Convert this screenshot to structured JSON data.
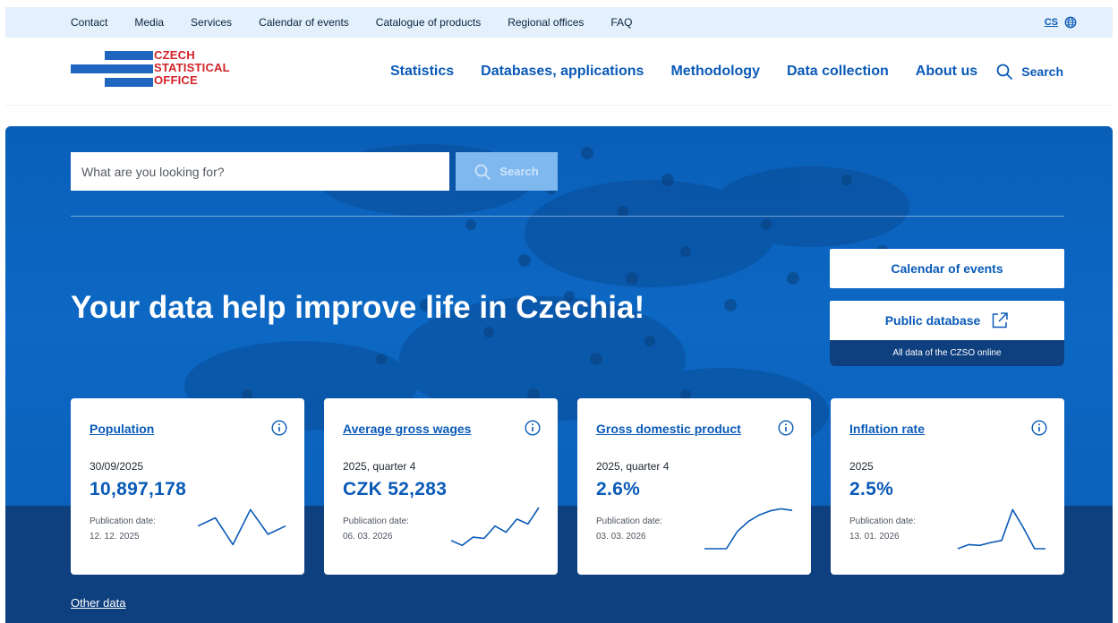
{
  "topbar": {
    "links": [
      "Contact",
      "Media",
      "Services",
      "Calendar of events",
      "Catalogue of products",
      "Regional offices",
      "FAQ"
    ],
    "lang": "CS",
    "globe_icon": "globe-icon"
  },
  "header": {
    "logo_lines": [
      "CZECH",
      "STATISTICAL",
      "OFFICE"
    ],
    "nav": [
      "Statistics",
      "Databases, applications",
      "Methodology",
      "Data collection",
      "About us"
    ],
    "search_label": "Search"
  },
  "hero": {
    "search_placeholder": "What are you looking for?",
    "search_button": "Search",
    "title": "Your data help improve life in Czechia!",
    "calendar_button": "Calendar of events",
    "public_db_button": "Public database",
    "public_db_caption": "All data of the CZSO online",
    "other_data": "Other data"
  },
  "cards": [
    {
      "title": "Population",
      "period": "30/09/2025",
      "value": "10,897,178",
      "pub_label": "Publication date:",
      "pub_date": "12. 12. 2025",
      "sparkline": [
        0.55,
        0.75,
        0.1,
        0.95,
        0.35,
        0.55
      ]
    },
    {
      "title": "Average gross wages",
      "period": "2025, quarter 4",
      "value": "CZK 52,283",
      "pub_label": "Publication date:",
      "pub_date": "06. 03. 2026",
      "sparkline": [
        0.2,
        0.08,
        0.28,
        0.25,
        0.55,
        0.4,
        0.72,
        0.6,
        1.0
      ]
    },
    {
      "title": "Gross domestic product",
      "period": "2025, quarter 4",
      "value": "2.6%",
      "pub_label": "Publication date:",
      "pub_date": "03. 03. 2026",
      "sparkline": [
        0.0,
        0.0,
        0.0,
        0.42,
        0.66,
        0.82,
        0.92,
        0.97,
        0.93
      ]
    },
    {
      "title": "Inflation rate",
      "period": "2025",
      "value": "2.5%",
      "pub_label": "Publication date:",
      "pub_date": "13. 01. 2026",
      "sparkline": [
        0.0,
        0.1,
        0.08,
        0.15,
        0.2,
        0.95,
        0.5,
        0.0,
        0.0
      ]
    }
  ],
  "colors": {
    "brand_blue": "#0a5ab7",
    "logo_red": "#d2232a",
    "hero_blue": "#0c68c4",
    "hero_dark": "#0e3f7e"
  }
}
